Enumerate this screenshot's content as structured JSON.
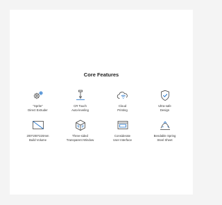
{
  "section": {
    "title": "Core Features"
  },
  "features": [
    {
      "icon": "gears-icon",
      "line1": "\"Sprite\"",
      "line2": "Direct Extruder"
    },
    {
      "icon": "probe-icon",
      "line1": "CR Touch",
      "line2": "Auto-leveling"
    },
    {
      "icon": "cloud-wifi-icon",
      "line1": "Cloud",
      "line2": "Printing"
    },
    {
      "icon": "shield-check-icon",
      "line1": "Ultra-safe",
      "line2": "Design"
    },
    {
      "icon": "build-plate-icon",
      "line1": "200*200*220mm",
      "line2": "Build Volume"
    },
    {
      "icon": "cube-window-icon",
      "line1": "Three-sided",
      "line2": "Transparent Window"
    },
    {
      "icon": "screen-ui-icon",
      "line1": "Considerate",
      "line2": "User Interface"
    },
    {
      "icon": "spring-sheet-icon",
      "line1": "Bendable Spring",
      "line2": "Steel Sheet"
    }
  ],
  "colors": {
    "accent": "#1a6fc9",
    "icon": "#444444",
    "text": "#333333",
    "background": "#f4f4f4",
    "card": "#ffffff"
  }
}
